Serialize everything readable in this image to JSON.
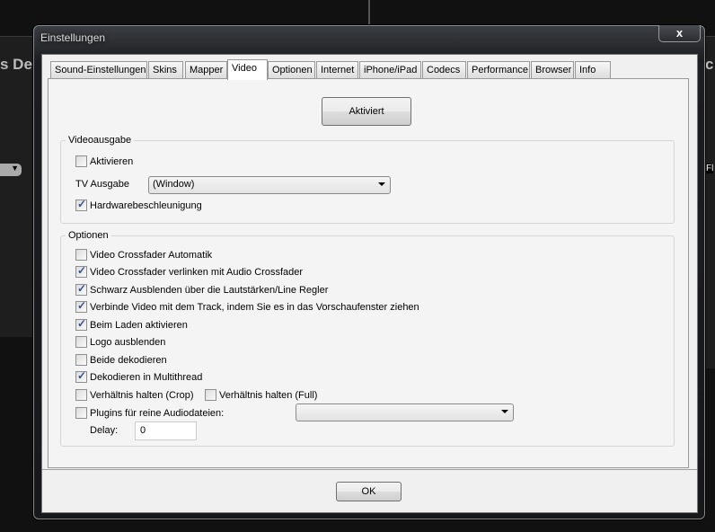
{
  "background_app": {
    "deck_title": "s Dec",
    "right_label_1": "c",
    "right_label_2": "Fl"
  },
  "dialog": {
    "title": "Einstellungen",
    "close_label": "x",
    "tabs": [
      {
        "label": "Sound-Einstellungen"
      },
      {
        "label": "Skins"
      },
      {
        "label": "Mapper"
      },
      {
        "label": "Video",
        "active": true
      },
      {
        "label": "Optionen"
      },
      {
        "label": "Internet"
      },
      {
        "label": "iPhone/iPad"
      },
      {
        "label": "Codecs"
      },
      {
        "label": "Performance"
      },
      {
        "label": "Browser"
      },
      {
        "label": "Info"
      }
    ],
    "activated_button": "Aktiviert",
    "videoausgabe": {
      "title": "Videoausgabe",
      "activate": {
        "label": "Aktivieren",
        "checked": false
      },
      "tv_label": "TV Ausgabe",
      "tv_value": "(Window)",
      "hw": {
        "label": "Hardwarebeschleunigung",
        "checked": true
      }
    },
    "optionen": {
      "title": "Optionen",
      "items": [
        {
          "label": "Video Crossfader Automatik",
          "checked": false
        },
        {
          "label": "Video Crossfader verlinken mit Audio Crossfader",
          "checked": true
        },
        {
          "label": "Schwarz Ausblenden über die Lautstärken/Line Regler",
          "checked": true
        },
        {
          "label": "Verbinde Video mit dem Track, indem Sie es in das Vorschaufenster ziehen",
          "checked": true
        },
        {
          "label": "Beim Laden aktivieren",
          "checked": true
        },
        {
          "label": "Logo ausblenden",
          "checked": false
        },
        {
          "label": "Beide dekodieren",
          "checked": false
        },
        {
          "label": "Dekodieren in Multithread",
          "checked": true
        }
      ],
      "crop": {
        "label": "Verhältnis halten (Crop)",
        "checked": false
      },
      "full": {
        "label": "Verhältnis halten (Full)",
        "checked": false
      },
      "plugins": {
        "label": "Plugins für reine Audiodateien:",
        "checked": false,
        "value": ""
      },
      "delay_label": "Delay:",
      "delay_value": "0"
    },
    "ok_label": "OK"
  }
}
